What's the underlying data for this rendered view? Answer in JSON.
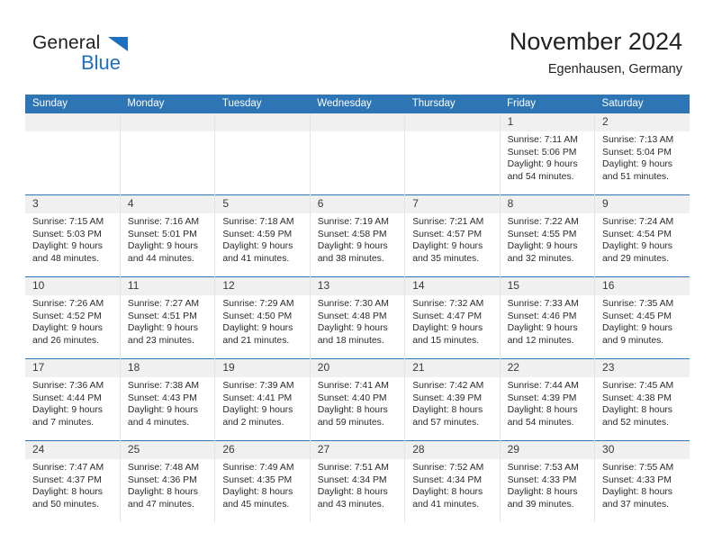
{
  "brand": {
    "name_part1": "General",
    "name_part2": "Blue",
    "accent_color": "#1e6fbf",
    "triangle_icon": "triangle-icon"
  },
  "header": {
    "title": "November 2024",
    "subtitle": "Egenhausen, Germany"
  },
  "theme": {
    "header_blue": "#2e75b6",
    "daynum_gray": "#f0f0f0",
    "cell_border": "#e4e4e4"
  },
  "weekday_headers": [
    "Sunday",
    "Monday",
    "Tuesday",
    "Wednesday",
    "Thursday",
    "Friday",
    "Saturday"
  ],
  "weeks": [
    [
      {
        "day": "",
        "sunrise": "",
        "sunset": "",
        "daylight_line1": "",
        "daylight_line2": ""
      },
      {
        "day": "",
        "sunrise": "",
        "sunset": "",
        "daylight_line1": "",
        "daylight_line2": ""
      },
      {
        "day": "",
        "sunrise": "",
        "sunset": "",
        "daylight_line1": "",
        "daylight_line2": ""
      },
      {
        "day": "",
        "sunrise": "",
        "sunset": "",
        "daylight_line1": "",
        "daylight_line2": ""
      },
      {
        "day": "",
        "sunrise": "",
        "sunset": "",
        "daylight_line1": "",
        "daylight_line2": ""
      },
      {
        "day": "1",
        "sunrise": "Sunrise: 7:11 AM",
        "sunset": "Sunset: 5:06 PM",
        "daylight_line1": "Daylight: 9 hours",
        "daylight_line2": "and 54 minutes."
      },
      {
        "day": "2",
        "sunrise": "Sunrise: 7:13 AM",
        "sunset": "Sunset: 5:04 PM",
        "daylight_line1": "Daylight: 9 hours",
        "daylight_line2": "and 51 minutes."
      }
    ],
    [
      {
        "day": "3",
        "sunrise": "Sunrise: 7:15 AM",
        "sunset": "Sunset: 5:03 PM",
        "daylight_line1": "Daylight: 9 hours",
        "daylight_line2": "and 48 minutes."
      },
      {
        "day": "4",
        "sunrise": "Sunrise: 7:16 AM",
        "sunset": "Sunset: 5:01 PM",
        "daylight_line1": "Daylight: 9 hours",
        "daylight_line2": "and 44 minutes."
      },
      {
        "day": "5",
        "sunrise": "Sunrise: 7:18 AM",
        "sunset": "Sunset: 4:59 PM",
        "daylight_line1": "Daylight: 9 hours",
        "daylight_line2": "and 41 minutes."
      },
      {
        "day": "6",
        "sunrise": "Sunrise: 7:19 AM",
        "sunset": "Sunset: 4:58 PM",
        "daylight_line1": "Daylight: 9 hours",
        "daylight_line2": "and 38 minutes."
      },
      {
        "day": "7",
        "sunrise": "Sunrise: 7:21 AM",
        "sunset": "Sunset: 4:57 PM",
        "daylight_line1": "Daylight: 9 hours",
        "daylight_line2": "and 35 minutes."
      },
      {
        "day": "8",
        "sunrise": "Sunrise: 7:22 AM",
        "sunset": "Sunset: 4:55 PM",
        "daylight_line1": "Daylight: 9 hours",
        "daylight_line2": "and 32 minutes."
      },
      {
        "day": "9",
        "sunrise": "Sunrise: 7:24 AM",
        "sunset": "Sunset: 4:54 PM",
        "daylight_line1": "Daylight: 9 hours",
        "daylight_line2": "and 29 minutes."
      }
    ],
    [
      {
        "day": "10",
        "sunrise": "Sunrise: 7:26 AM",
        "sunset": "Sunset: 4:52 PM",
        "daylight_line1": "Daylight: 9 hours",
        "daylight_line2": "and 26 minutes."
      },
      {
        "day": "11",
        "sunrise": "Sunrise: 7:27 AM",
        "sunset": "Sunset: 4:51 PM",
        "daylight_line1": "Daylight: 9 hours",
        "daylight_line2": "and 23 minutes."
      },
      {
        "day": "12",
        "sunrise": "Sunrise: 7:29 AM",
        "sunset": "Sunset: 4:50 PM",
        "daylight_line1": "Daylight: 9 hours",
        "daylight_line2": "and 21 minutes."
      },
      {
        "day": "13",
        "sunrise": "Sunrise: 7:30 AM",
        "sunset": "Sunset: 4:48 PM",
        "daylight_line1": "Daylight: 9 hours",
        "daylight_line2": "and 18 minutes."
      },
      {
        "day": "14",
        "sunrise": "Sunrise: 7:32 AM",
        "sunset": "Sunset: 4:47 PM",
        "daylight_line1": "Daylight: 9 hours",
        "daylight_line2": "and 15 minutes."
      },
      {
        "day": "15",
        "sunrise": "Sunrise: 7:33 AM",
        "sunset": "Sunset: 4:46 PM",
        "daylight_line1": "Daylight: 9 hours",
        "daylight_line2": "and 12 minutes."
      },
      {
        "day": "16",
        "sunrise": "Sunrise: 7:35 AM",
        "sunset": "Sunset: 4:45 PM",
        "daylight_line1": "Daylight: 9 hours",
        "daylight_line2": "and 9 minutes."
      }
    ],
    [
      {
        "day": "17",
        "sunrise": "Sunrise: 7:36 AM",
        "sunset": "Sunset: 4:44 PM",
        "daylight_line1": "Daylight: 9 hours",
        "daylight_line2": "and 7 minutes."
      },
      {
        "day": "18",
        "sunrise": "Sunrise: 7:38 AM",
        "sunset": "Sunset: 4:43 PM",
        "daylight_line1": "Daylight: 9 hours",
        "daylight_line2": "and 4 minutes."
      },
      {
        "day": "19",
        "sunrise": "Sunrise: 7:39 AM",
        "sunset": "Sunset: 4:41 PM",
        "daylight_line1": "Daylight: 9 hours",
        "daylight_line2": "and 2 minutes."
      },
      {
        "day": "20",
        "sunrise": "Sunrise: 7:41 AM",
        "sunset": "Sunset: 4:40 PM",
        "daylight_line1": "Daylight: 8 hours",
        "daylight_line2": "and 59 minutes."
      },
      {
        "day": "21",
        "sunrise": "Sunrise: 7:42 AM",
        "sunset": "Sunset: 4:39 PM",
        "daylight_line1": "Daylight: 8 hours",
        "daylight_line2": "and 57 minutes."
      },
      {
        "day": "22",
        "sunrise": "Sunrise: 7:44 AM",
        "sunset": "Sunset: 4:39 PM",
        "daylight_line1": "Daylight: 8 hours",
        "daylight_line2": "and 54 minutes."
      },
      {
        "day": "23",
        "sunrise": "Sunrise: 7:45 AM",
        "sunset": "Sunset: 4:38 PM",
        "daylight_line1": "Daylight: 8 hours",
        "daylight_line2": "and 52 minutes."
      }
    ],
    [
      {
        "day": "24",
        "sunrise": "Sunrise: 7:47 AM",
        "sunset": "Sunset: 4:37 PM",
        "daylight_line1": "Daylight: 8 hours",
        "daylight_line2": "and 50 minutes."
      },
      {
        "day": "25",
        "sunrise": "Sunrise: 7:48 AM",
        "sunset": "Sunset: 4:36 PM",
        "daylight_line1": "Daylight: 8 hours",
        "daylight_line2": "and 47 minutes."
      },
      {
        "day": "26",
        "sunrise": "Sunrise: 7:49 AM",
        "sunset": "Sunset: 4:35 PM",
        "daylight_line1": "Daylight: 8 hours",
        "daylight_line2": "and 45 minutes."
      },
      {
        "day": "27",
        "sunrise": "Sunrise: 7:51 AM",
        "sunset": "Sunset: 4:34 PM",
        "daylight_line1": "Daylight: 8 hours",
        "daylight_line2": "and 43 minutes."
      },
      {
        "day": "28",
        "sunrise": "Sunrise: 7:52 AM",
        "sunset": "Sunset: 4:34 PM",
        "daylight_line1": "Daylight: 8 hours",
        "daylight_line2": "and 41 minutes."
      },
      {
        "day": "29",
        "sunrise": "Sunrise: 7:53 AM",
        "sunset": "Sunset: 4:33 PM",
        "daylight_line1": "Daylight: 8 hours",
        "daylight_line2": "and 39 minutes."
      },
      {
        "day": "30",
        "sunrise": "Sunrise: 7:55 AM",
        "sunset": "Sunset: 4:33 PM",
        "daylight_line1": "Daylight: 8 hours",
        "daylight_line2": "and 37 minutes."
      }
    ]
  ]
}
